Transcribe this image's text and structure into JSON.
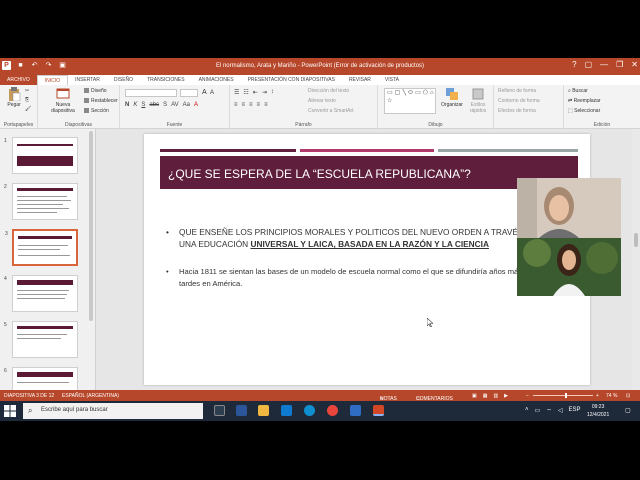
{
  "window": {
    "title": "El normalismo, Arata y Mariño  -  PowerPoint (Error de activación de productos)",
    "app_icon": "P",
    "qat_icons": [
      "save-icon",
      "undo-icon",
      "redo-icon",
      "present-icon"
    ],
    "controls": [
      "?",
      "▢",
      "—",
      "❐",
      "✕"
    ]
  },
  "tabs": [
    "ARCHIVO",
    "INICIO",
    "INSERTAR",
    "DISEÑO",
    "TRANSICIONES",
    "ANIMACIONES",
    "PRESENTACIÓN CON DIAPOSITIVAS",
    "REVISAR",
    "VISTA"
  ],
  "ribbon": {
    "paste": "Pegar",
    "new_slide": "Nueva diapositiva",
    "slide_opts": [
      "Diseño",
      "Restablecer",
      "Sección"
    ],
    "font_format": [
      "N",
      "K",
      "S",
      "abc",
      "S",
      "AV",
      "Aa",
      "A"
    ],
    "para_format": [
      "≡",
      "≡",
      "≡",
      "≡",
      "≡"
    ],
    "para_opts": [
      "Dirección del texto",
      "Alinear texto",
      "Convertir a SmartArt"
    ],
    "shapes": "▭▢╲⬭▭⬠⌂▽╲⌐☐◯⌂╭◠{}☆",
    "organize": "Organizar",
    "quick_styles": "Estilos rápidos",
    "drawing_opts": [
      "Relleno de forma",
      "Contorno de forma",
      "Efectos de forma"
    ],
    "edit_opts": [
      "Buscar",
      "Reemplazar",
      "Seleccionar"
    ],
    "group_labels": [
      "Portapapeles",
      "Diapositivas",
      "Fuente",
      "Párrafo",
      "Dibujo",
      "Edición"
    ]
  },
  "thumbnails": [
    {
      "num": "1"
    },
    {
      "num": "2"
    },
    {
      "num": "3"
    },
    {
      "num": "4"
    },
    {
      "num": "5"
    },
    {
      "num": "6"
    }
  ],
  "slide": {
    "title": "¿QUE SE ESPERA DE LA “ESCUELA REPUBLICANA”?",
    "bullet1_line1": "QUE ENSEÑE LOS PRINCIPIOS MORALES Y POLITICOS DEL NUEVO ORDEN A TRAVÉS  DE",
    "bullet1_line2_prefix": "UNA EDUCACIÓN ",
    "bullet1_line2_bold": "UNIVERSAL Y LAICA, BASADA EN LA RAZÓN Y LA CIENCIA",
    "bullet2_line1": "Hacia 1811 se sientan las bases de un modelo de escuela normal como el que se difundiría años más",
    "bullet2_line2": "tardes en América.",
    "bullet_char": "•"
  },
  "status": {
    "slide_info": "DIAPOSITIVA 3 DE 12",
    "language": "ESPAÑOL (ARGENTINA)",
    "notes": "NOTAS",
    "comments": "COMENTARIOS",
    "zoom": "74 %"
  },
  "taskbar": {
    "search_placeholder": "Escribe aquí para buscar",
    "language": "ESP",
    "time": "09:23",
    "date": "12/4/2021"
  },
  "colors": {
    "accent": "#b7472a",
    "title_bar": "#5e1e3c",
    "deco1": "#5e1e3c",
    "deco2": "#b03a6a",
    "deco3": "#9aa5a8"
  }
}
